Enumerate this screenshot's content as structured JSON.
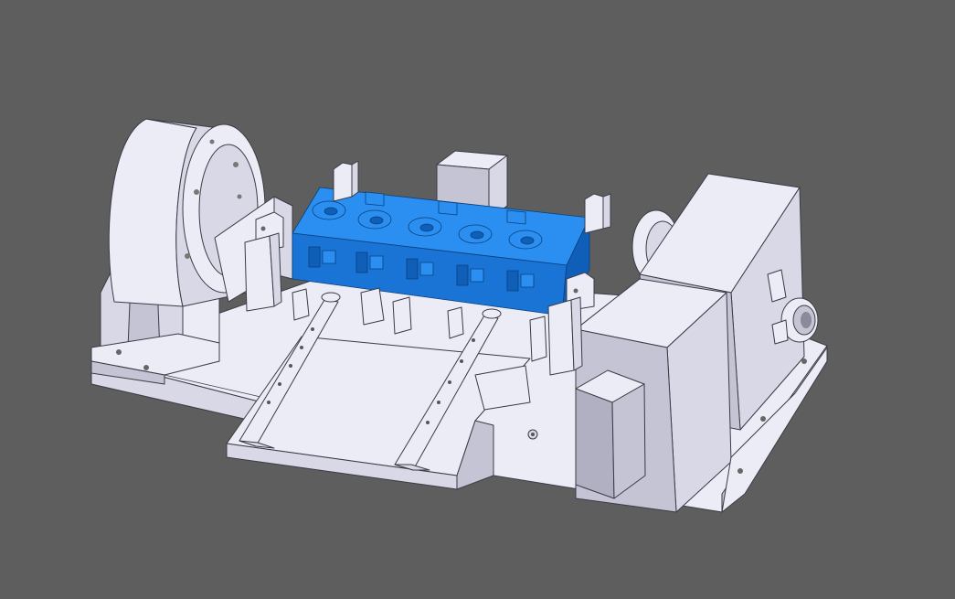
{
  "scene": {
    "background_color": "#5e5e5e",
    "part_color": "#1f80e6",
    "fixture_color": "#e6e6f2",
    "edge_color": "#3b3b46",
    "selected_component": "cylinder-head"
  }
}
